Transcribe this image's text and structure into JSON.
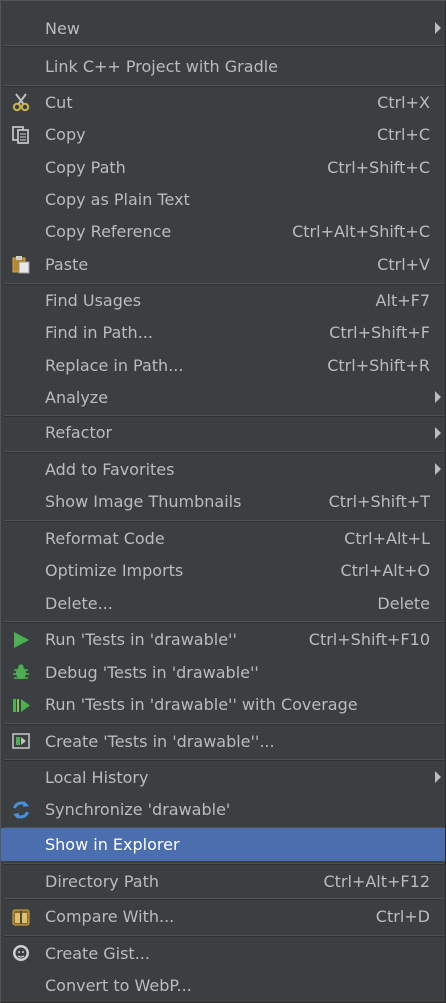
{
  "menu": {
    "items": [
      {
        "label": "New",
        "shortcut": "",
        "submenu": true
      },
      {
        "label": "Link C++ Project with Gradle",
        "shortcut": ""
      },
      {
        "label": "Cut",
        "shortcut": "Ctrl+X",
        "icon": "scissors-icon"
      },
      {
        "label": "Copy",
        "shortcut": "Ctrl+C",
        "icon": "copy-icon"
      },
      {
        "label": "Copy Path",
        "shortcut": "Ctrl+Shift+C"
      },
      {
        "label": "Copy as Plain Text",
        "shortcut": ""
      },
      {
        "label": "Copy Reference",
        "shortcut": "Ctrl+Alt+Shift+C"
      },
      {
        "label": "Paste",
        "shortcut": "Ctrl+V",
        "icon": "paste-icon"
      },
      {
        "label": "Find Usages",
        "shortcut": "Alt+F7"
      },
      {
        "label": "Find in Path...",
        "shortcut": "Ctrl+Shift+F"
      },
      {
        "label": "Replace in Path...",
        "shortcut": "Ctrl+Shift+R"
      },
      {
        "label": "Analyze",
        "shortcut": "",
        "submenu": true
      },
      {
        "label": "Refactor",
        "shortcut": "",
        "submenu": true
      },
      {
        "label": "Add to Favorites",
        "shortcut": "",
        "submenu": true
      },
      {
        "label": "Show Image Thumbnails",
        "shortcut": "Ctrl+Shift+T"
      },
      {
        "label": "Reformat Code",
        "shortcut": "Ctrl+Alt+L"
      },
      {
        "label": "Optimize Imports",
        "shortcut": "Ctrl+Alt+O"
      },
      {
        "label": "Delete...",
        "shortcut": "Delete"
      },
      {
        "label": "Run 'Tests in 'drawable''",
        "shortcut": "Ctrl+Shift+F10",
        "icon": "run-icon"
      },
      {
        "label": "Debug 'Tests in 'drawable''",
        "shortcut": "",
        "icon": "debug-icon"
      },
      {
        "label": "Run 'Tests in 'drawable'' with Coverage",
        "shortcut": "",
        "icon": "coverage-icon"
      },
      {
        "label": "Create 'Tests in 'drawable''...",
        "shortcut": "",
        "icon": "create-test-icon"
      },
      {
        "label": "Local History",
        "shortcut": "",
        "submenu": true
      },
      {
        "label": "Synchronize 'drawable'",
        "shortcut": "",
        "icon": "sync-icon"
      },
      {
        "label": "Show in Explorer",
        "shortcut": "",
        "selected": true
      },
      {
        "label": "Directory Path",
        "shortcut": "Ctrl+Alt+F12"
      },
      {
        "label": "Compare With...",
        "shortcut": "Ctrl+D",
        "icon": "compare-icon"
      },
      {
        "label": "Create Gist...",
        "shortcut": "",
        "icon": "github-icon"
      },
      {
        "label": "Convert to WebP...",
        "shortcut": ""
      }
    ]
  }
}
